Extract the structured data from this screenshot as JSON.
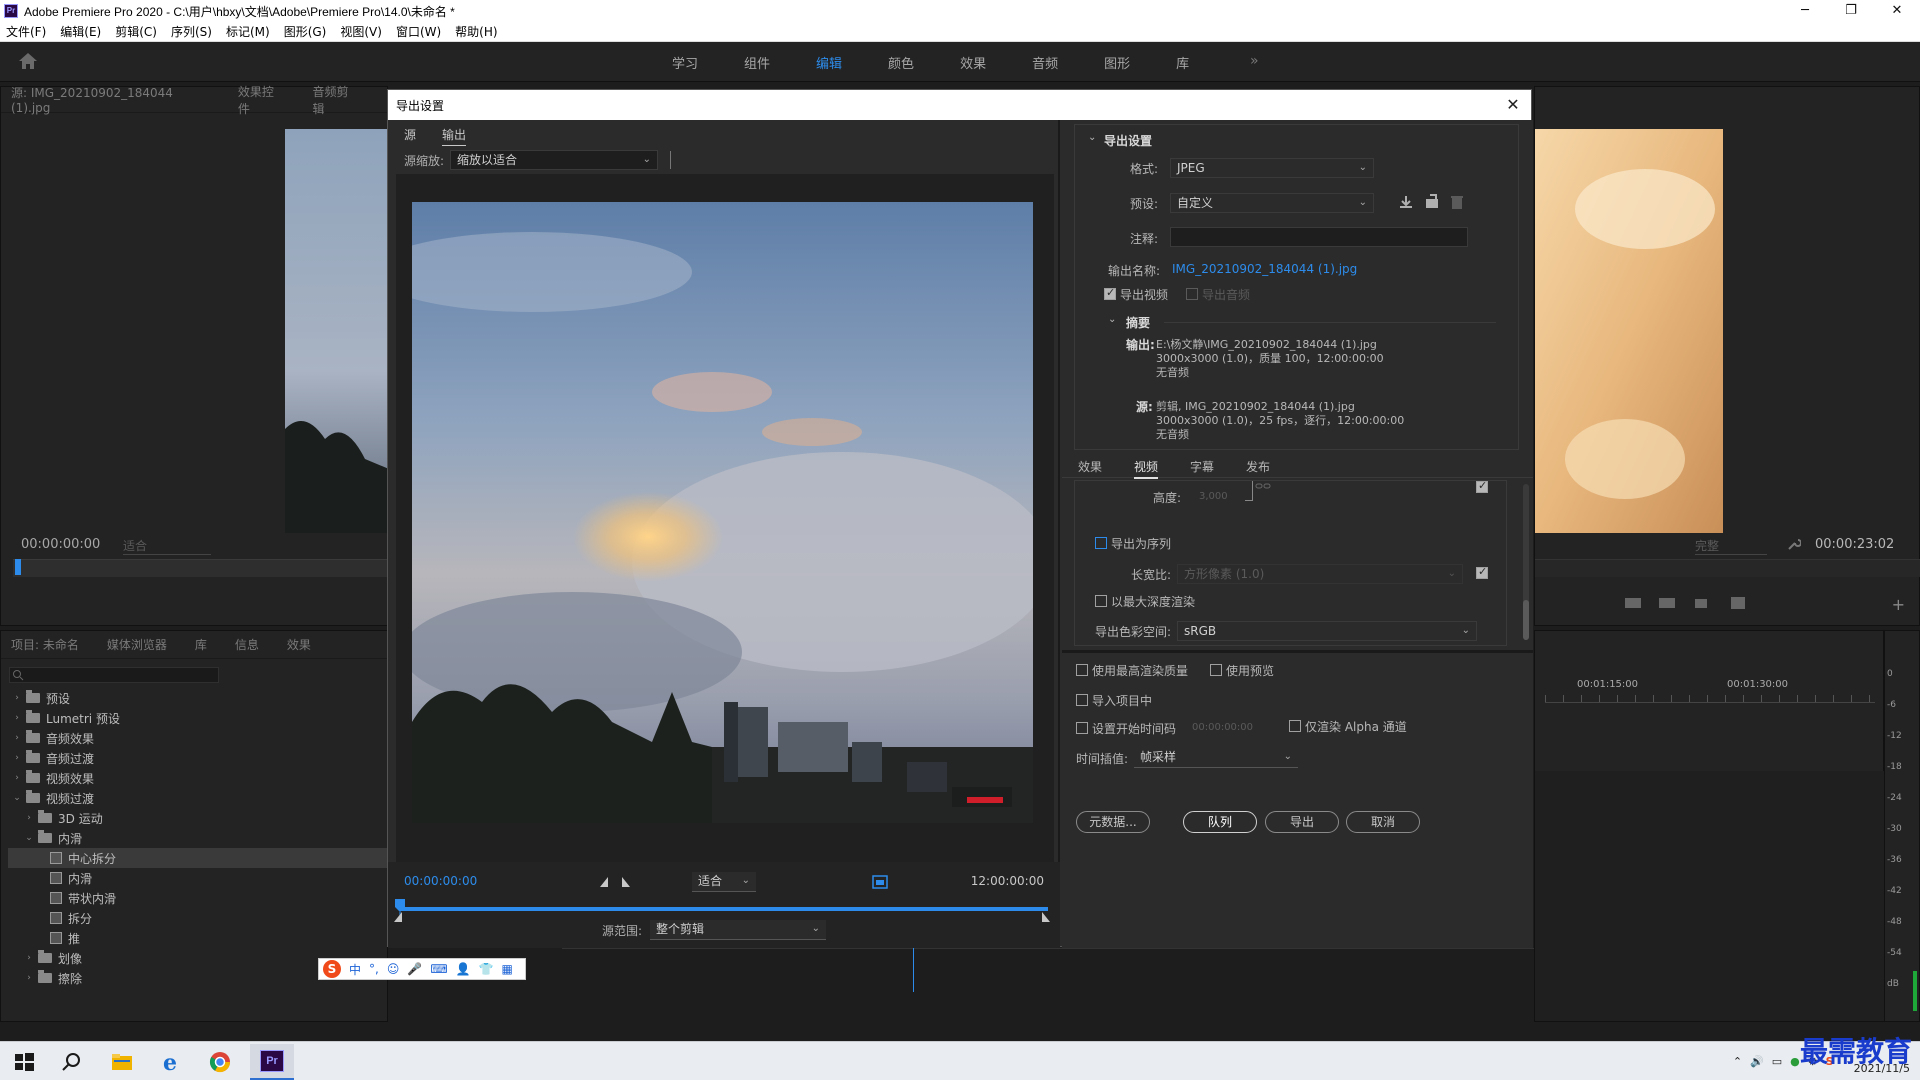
{
  "window": {
    "title": "Adobe Premiere Pro 2020 - C:\\用户\\hbxy\\文档\\Adobe\\Premiere Pro\\14.0\\未命名 *",
    "controls": [
      "─",
      "❐",
      "✕"
    ]
  },
  "menu": [
    "文件(F)",
    "编辑(E)",
    "剪辑(C)",
    "序列(S)",
    "标记(M)",
    "图形(G)",
    "视图(V)",
    "窗口(W)",
    "帮助(H)"
  ],
  "workspaces": {
    "tabs": [
      "学习",
      "组件",
      "编辑",
      "颜色",
      "效果",
      "音频",
      "图形",
      "库"
    ],
    "active": "编辑",
    "more": "»"
  },
  "source_panel": {
    "tabs": [
      "源: IMG_20210902_184044 (1).jpg",
      "效果控件",
      "音频剪辑"
    ],
    "timecode": "00:00:00:00",
    "zoom": "适合"
  },
  "program_panel": {
    "timecode": "00:00:23:02",
    "quality": "完整"
  },
  "project_panel": {
    "tabs": [
      "项目: 未命名",
      "媒体浏览器",
      "库",
      "信息",
      "效果"
    ]
  },
  "effects_tree": [
    {
      "label": "预设",
      "type": "folder",
      "indent": 0,
      "open": false
    },
    {
      "label": "Lumetri 预设",
      "type": "folder",
      "indent": 0,
      "open": false
    },
    {
      "label": "音频效果",
      "type": "folder",
      "indent": 0,
      "open": false
    },
    {
      "label": "音频过渡",
      "type": "folder",
      "indent": 0,
      "open": false
    },
    {
      "label": "视频效果",
      "type": "folder",
      "indent": 0,
      "open": false
    },
    {
      "label": "视频过渡",
      "type": "folder",
      "indent": 0,
      "open": true
    },
    {
      "label": "3D 运动",
      "type": "folder",
      "indent": 1,
      "open": false
    },
    {
      "label": "内滑",
      "type": "folder",
      "indent": 1,
      "open": true
    },
    {
      "label": "中心拆分",
      "type": "fx",
      "indent": 2,
      "selected": true
    },
    {
      "label": "内滑",
      "type": "fx",
      "indent": 2
    },
    {
      "label": "带状内滑",
      "type": "fx",
      "indent": 2
    },
    {
      "label": "拆分",
      "type": "fx",
      "indent": 2
    },
    {
      "label": "推",
      "type": "fx",
      "indent": 2
    },
    {
      "label": "划像",
      "type": "folder",
      "indent": 1,
      "open": false
    },
    {
      "label": "擦除",
      "type": "folder",
      "indent": 1,
      "open": false
    }
  ],
  "timeline": {
    "ruler": [
      "00:01:15:00",
      "00:01:30:00"
    ]
  },
  "audio_meter": [
    "0",
    "-6",
    "-12",
    "-18",
    "-24",
    "-30",
    "-36",
    "-42",
    "-48",
    "-54",
    "dB"
  ],
  "dialog": {
    "title": "导出设置",
    "close": "✕",
    "source_tabs": [
      "源",
      "输出"
    ],
    "active_source_tab": "输出",
    "source_scaling_label": "源缩放:",
    "source_scaling_value": "缩放以适合",
    "timecode_start": "00:00:00:00",
    "timecode_end": "12:00:00:00",
    "fit_value": "适合",
    "source_range_label": "源范围:",
    "source_range_value": "整个剪辑",
    "export_settings": {
      "header": "导出设置",
      "format_label": "格式:",
      "format_value": "JPEG",
      "preset_label": "预设:",
      "preset_value": "自定义",
      "comment_label": "注释:",
      "comment_value": "",
      "output_name_label": "输出名称:",
      "output_name_value": "IMG_20210902_184044 (1).jpg",
      "export_video": "导出视频",
      "export_video_checked": true,
      "export_audio": "导出音频",
      "export_audio_checked": false
    },
    "summary": {
      "header": "摘要",
      "output_label": "输出:",
      "output_lines": [
        "E:\\杨文静\\IMG_20210902_184044 (1).jpg",
        "3000x3000 (1.0)，质量 100，12:00:00:00",
        "无音频"
      ],
      "source_label": "源:",
      "source_lines": [
        "剪辑, IMG_20210902_184044 (1).jpg",
        "3000x3000 (1.0)，25 fps，逐行，12:00:00:00",
        "无音频"
      ]
    },
    "tabs": [
      "效果",
      "视频",
      "字幕",
      "发布"
    ],
    "active_tab": "视频",
    "video": {
      "height_label": "高度:",
      "height_value": "3,000",
      "export_sequence": "导出为序列",
      "aspect_label": "长宽比:",
      "aspect_value": "方形像素 (1.0)",
      "max_depth": "以最大深度渲染",
      "colorspace_label": "导出色彩空间:",
      "colorspace_value": "sRGB"
    },
    "options": {
      "max_quality": "使用最高渲染质量",
      "use_previews": "使用预览",
      "import_project": "导入项目中",
      "set_start_tc": "设置开始时间码",
      "start_tc_value": "00:00:00:00",
      "alpha_only": "仅渲染 Alpha 通道",
      "interp_label": "时间插值:",
      "interp_value": "帧采样"
    },
    "buttons": {
      "metadata": "元数据...",
      "queue": "队列",
      "export": "导出",
      "cancel": "取消"
    }
  },
  "taskbar": {
    "clock": "2021/11/5",
    "brand": "最需教育"
  },
  "ime": [
    "S",
    "中",
    "°,",
    "☺",
    "🎤",
    "⌨",
    "👤",
    "👕",
    "▦"
  ],
  "colors": {
    "accent": "#2d8ceb",
    "panel": "#232323",
    "dialog": "#2b2b2b"
  }
}
